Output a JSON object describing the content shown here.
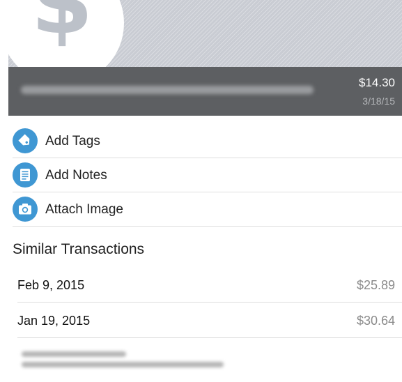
{
  "transaction": {
    "amount": "$14.30",
    "date": "3/18/15",
    "logo_symbol": "$",
    "merchant_redacted": true
  },
  "actions": [
    {
      "label": "Add Tags",
      "icon": "tag-icon"
    },
    {
      "label": "Add Notes",
      "icon": "notes-icon"
    },
    {
      "label": "Attach Image",
      "icon": "camera-icon"
    }
  ],
  "similar": {
    "title": "Similar Transactions",
    "items": [
      {
        "date": "Feb 9, 2015",
        "amount": "$25.89"
      },
      {
        "date": "Jan 19, 2015",
        "amount": "$30.64"
      }
    ]
  },
  "colors": {
    "accent": "#3f97d3",
    "summary_bar": "#5d5f62",
    "header_background": "#c9ccd3"
  }
}
